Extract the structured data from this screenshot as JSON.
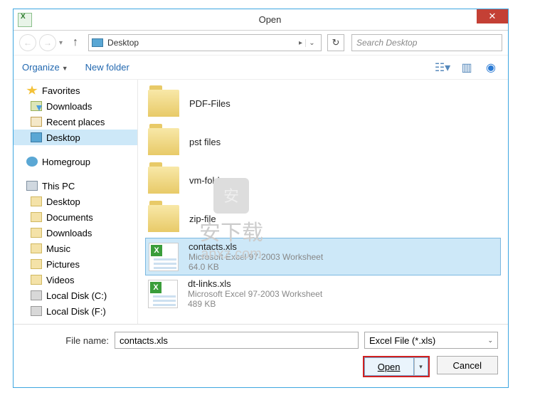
{
  "title": "Open",
  "breadcrumb": {
    "location": "Desktop"
  },
  "search": {
    "placeholder": "Search Desktop"
  },
  "toolbar": {
    "organize": "Organize",
    "newfolder": "New folder"
  },
  "sidebar": {
    "favorites": {
      "label": "Favorites",
      "items": [
        {
          "label": "Downloads"
        },
        {
          "label": "Recent places"
        },
        {
          "label": "Desktop"
        }
      ]
    },
    "homegroup": {
      "label": "Homegroup"
    },
    "thispc": {
      "label": "This PC",
      "items": [
        {
          "label": "Desktop"
        },
        {
          "label": "Documents"
        },
        {
          "label": "Downloads"
        },
        {
          "label": "Music"
        },
        {
          "label": "Pictures"
        },
        {
          "label": "Videos"
        },
        {
          "label": "Local Disk (C:)"
        },
        {
          "label": "Local Disk (F:)"
        }
      ]
    }
  },
  "files": {
    "folders": [
      {
        "name": "PDF-Files"
      },
      {
        "name": "pst files"
      },
      {
        "name": "vm-folder"
      },
      {
        "name": "zip-file"
      }
    ],
    "items": [
      {
        "name": "contacts.xls",
        "type": "Microsoft Excel 97-2003 Worksheet",
        "size": "64.0 KB",
        "selected": true
      },
      {
        "name": "dt-links.xls",
        "type": "Microsoft Excel 97-2003 Worksheet",
        "size": "489 KB",
        "selected": false
      }
    ]
  },
  "footer": {
    "filename_label": "File name:",
    "filename_value": "contacts.xls",
    "filter": "Excel File (*.xls)",
    "open": "Open",
    "cancel": "Cancel"
  },
  "watermark": {
    "text1": "安下载",
    "text2": "anxz.com"
  }
}
